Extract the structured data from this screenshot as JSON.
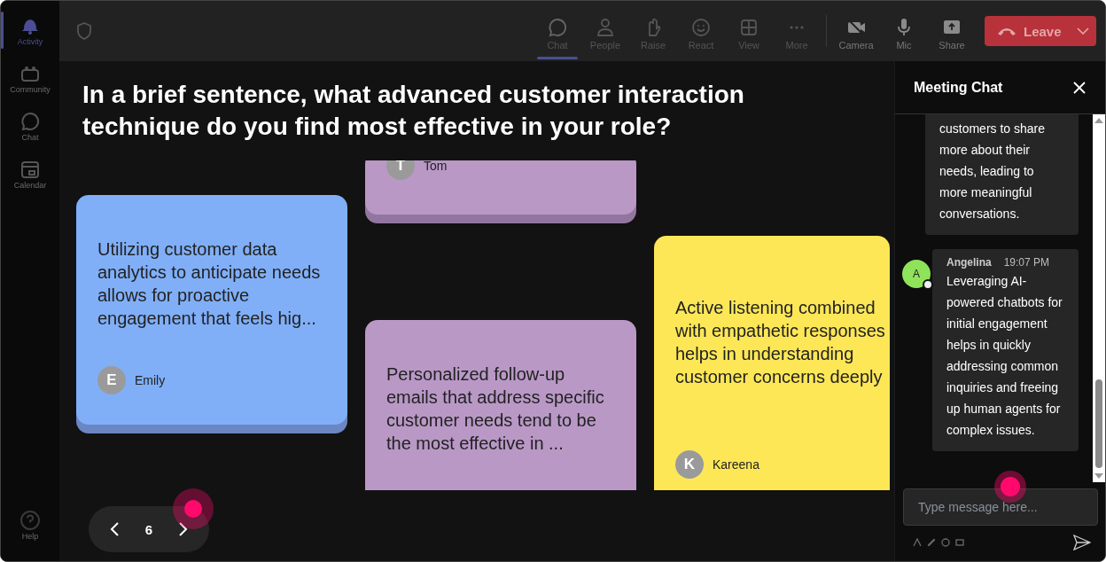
{
  "sidebar": {
    "items": [
      {
        "label": "Activity",
        "selected": true
      },
      {
        "label": "Community",
        "selected": false
      },
      {
        "label": "Chat",
        "selected": false
      },
      {
        "label": "Calendar",
        "selected": false
      }
    ],
    "help": {
      "label": "Help"
    }
  },
  "toolbar": {
    "items": [
      {
        "label": "Chat",
        "selected": true
      },
      {
        "label": "People",
        "selected": false
      },
      {
        "label": "Raise",
        "selected": false
      },
      {
        "label": "React",
        "selected": false
      },
      {
        "label": "View",
        "selected": false
      },
      {
        "label": "More",
        "selected": false
      }
    ],
    "devices": [
      {
        "label": "Camera"
      },
      {
        "label": "Mic"
      },
      {
        "label": "Share"
      }
    ],
    "leave": {
      "label": "Leave"
    }
  },
  "question": "In a brief sentence, what advanced customer interaction technique do you find most effective in your role?",
  "cards": [
    {
      "author": "Tom",
      "initial": "T",
      "color": "#b998c6"
    },
    {
      "text": "Utilizing customer data analytics to anticipate needs allows for proactive engagement that feels hig...",
      "author": "Emily",
      "initial": "E",
      "color": "#80aff8"
    },
    {
      "text": "Personalized follow-up emails that address specific customer needs tend to be the most effective in ...",
      "color": "#b998c6"
    },
    {
      "text": "Active listening combined with empathetic responses helps in understanding customer concerns deeply",
      "author": "Kareena",
      "initial": "K",
      "color": "#fde757"
    }
  ],
  "pager": {
    "page": "6"
  },
  "chat": {
    "title": "Meeting Chat",
    "messages": [
      {
        "text": "customers to share more about their needs, leading to more meaningful conversations."
      },
      {
        "initial": "A",
        "author": "Angelina",
        "time": "19:07 PM",
        "text": "Leveraging AI-powered chatbots for initial engagement helps in quickly addressing common inquiries and freeing up human agents for complex issues."
      }
    ],
    "input": {
      "placeholder": "Type message here..."
    }
  }
}
